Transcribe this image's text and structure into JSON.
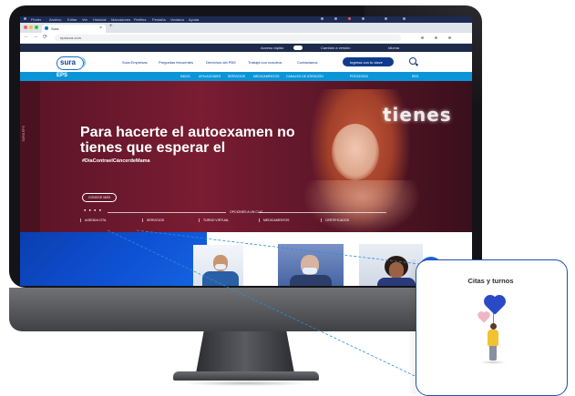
{
  "browser": {
    "tab_title": "Sura",
    "tab_close": "×",
    "new_tab": "+",
    "address": "epssura.com",
    "nav_back": "←",
    "nav_forward": "→",
    "nav_reload": "⟳"
  },
  "os_bar": {
    "items": [
      "Finder",
      "Archivo",
      "Editar",
      "Ver",
      "Historial",
      "Marcadores",
      "Perfiles",
      "Pestaña",
      "Ventana",
      "Ayuda"
    ]
  },
  "util_bar": {
    "items": [
      "Acceso rápido",
      "Cambiar a versión",
      "Idioma"
    ]
  },
  "header": {
    "logo": "sura",
    "nav": [
      "Sura Empresas",
      "Preguntas frecuentes",
      "Derechos del PBS",
      "Trabaja con nosotros",
      "Contáctanos"
    ],
    "cta": "Ingresa con tu clave"
  },
  "eps_bar": {
    "label": "EPS",
    "items": [
      "INICIO",
      "AFILIACIONES",
      "SERVICIOS",
      "MEDICAMENTOS",
      "CANALES DE ATENCIÓN",
      "PROCESOS",
      "RED"
    ]
  },
  "hero": {
    "title": "Para hacerte el autoexamen no tienes que esperar el",
    "subtitle": "#DíaContraelCáncerdeMama",
    "button": "CONOCE MÁS",
    "neon": "tienes",
    "dots": "● ● ● ●",
    "side_text": "SURA EPS",
    "options_label": "OPCIONES A UN CLIC",
    "options": [
      "AGENDA CITA",
      "SERVICIOS",
      "TURNO VIRTUAL",
      "MEDICAMENTOS",
      "CERTIFICADOS"
    ]
  },
  "content": {
    "fab": "Chat"
  },
  "callout": {
    "title": "Citas y turnos"
  },
  "colors": {
    "brand_navy": "#0f3b8c",
    "eps_blue": "#0a95d8",
    "hero_maroon": "#7a1c32",
    "callout_border": "#1e4fa8"
  }
}
